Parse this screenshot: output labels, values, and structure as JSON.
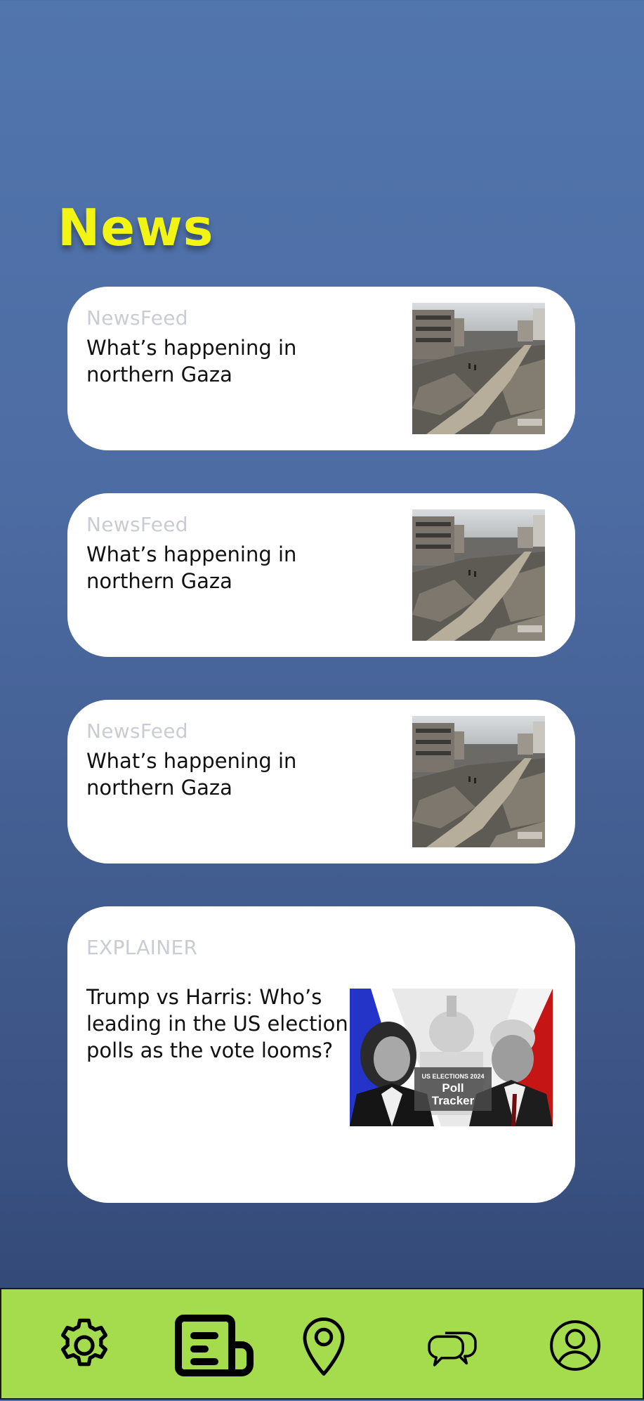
{
  "page": {
    "title": "News"
  },
  "news_cards": [
    {
      "kicker": "NewsFeed",
      "headline": "What’s happening in northern Gaza",
      "image": "rubble-street-photo"
    },
    {
      "kicker": "NewsFeed",
      "headline": "What’s happening in northern Gaza",
      "image": "rubble-street-photo"
    },
    {
      "kicker": "NewsFeed",
      "headline": "What’s happening in northern Gaza",
      "image": "rubble-street-photo"
    }
  ],
  "explainer_card": {
    "kicker": "EXPLAINER",
    "headline": "Trump vs Harris: Who’s leading in the US election polls as the vote looms?",
    "image": {
      "name": "poll-tracker-graphic",
      "caption_small": "US ELECTIONS 2024",
      "caption_big_1": "Poll",
      "caption_big_2": "Tracker"
    }
  },
  "bottom_nav": {
    "items": [
      {
        "icon": "settings-gear-icon",
        "active": false
      },
      {
        "icon": "news-icon",
        "active": true
      },
      {
        "icon": "location-pin-icon",
        "active": false
      },
      {
        "icon": "chat-bubbles-icon",
        "active": false
      },
      {
        "icon": "profile-icon",
        "active": false
      }
    ]
  },
  "colors": {
    "title": "#f2f514",
    "nav_bg": "#a5dc4d",
    "bg_top": "#5175ad",
    "bg_bottom": "#2f4470",
    "kicker": "#c9ccd2"
  }
}
